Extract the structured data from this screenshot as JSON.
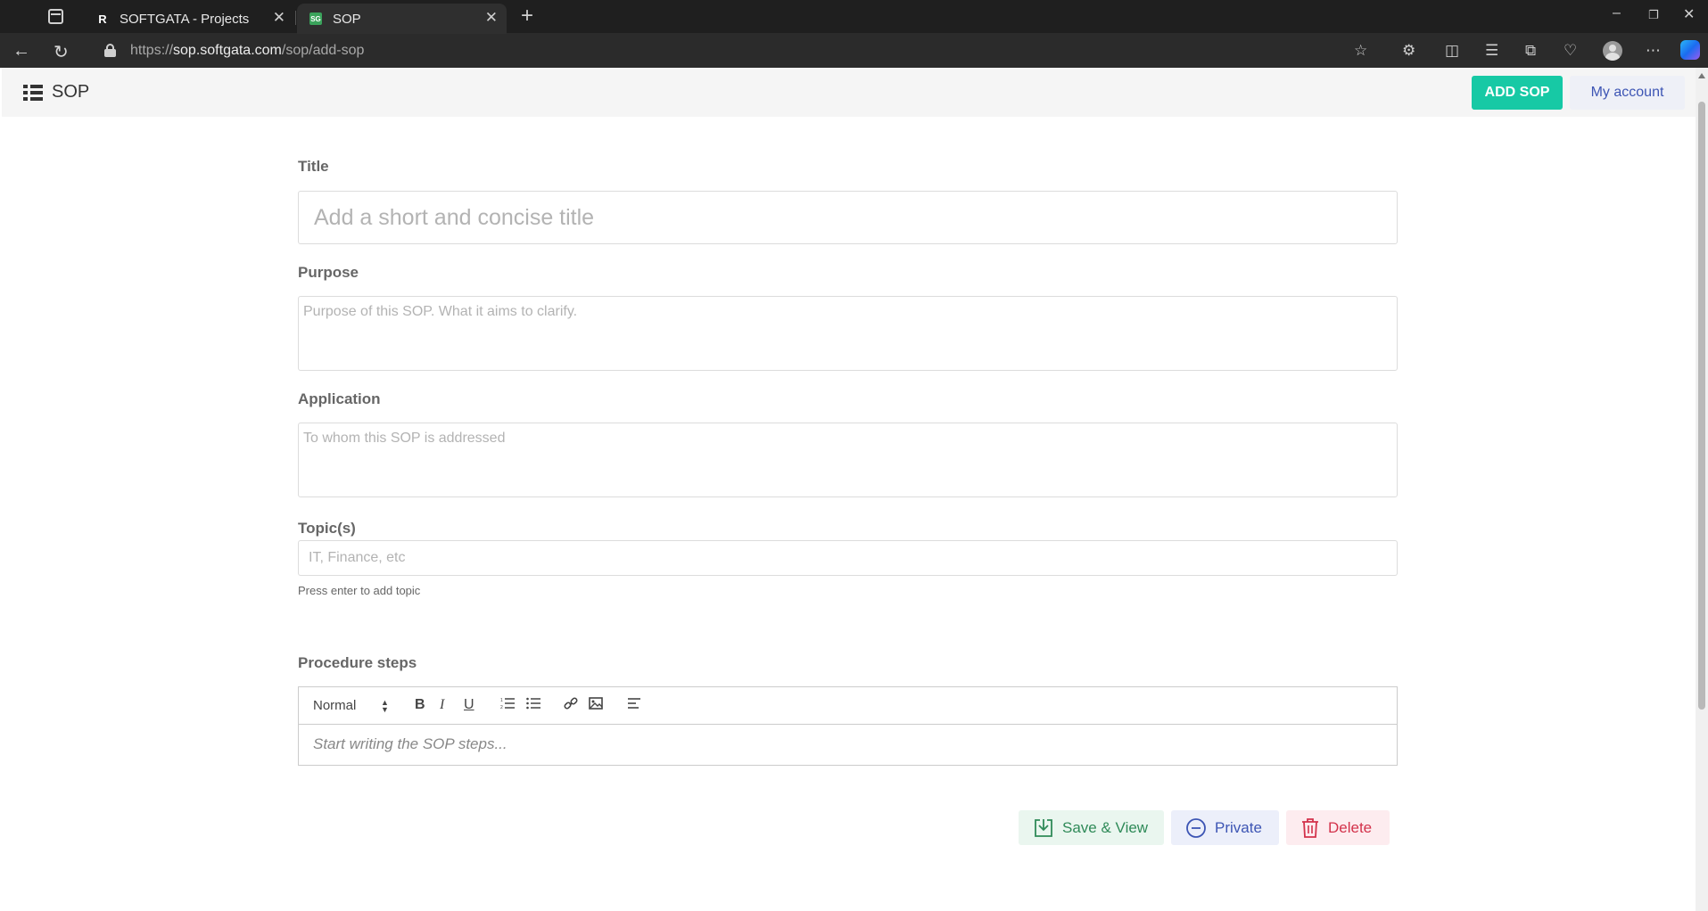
{
  "browser": {
    "tabs": [
      {
        "title": "SOFTGATA - Projects",
        "favicon": "R",
        "active": false
      },
      {
        "title": "SOP",
        "favicon": "SG",
        "active": true
      }
    ],
    "url_scheme": "https://",
    "url_host": "sop.softgata.com",
    "url_path": "/sop/add-sop"
  },
  "header": {
    "brand": "SOP",
    "add_sop_label": "ADD SOP",
    "my_account_label": "My account"
  },
  "form": {
    "title_label": "Title",
    "title_placeholder": "Add a short and concise title",
    "purpose_label": "Purpose",
    "purpose_placeholder": "Purpose of this SOP. What it aims to clarify.",
    "application_label": "Application",
    "application_placeholder": "To whom this SOP is addressed",
    "topics_label": "Topic(s)",
    "topics_placeholder": "IT, Finance, etc",
    "topics_help": "Press enter to add topic",
    "procedure_label": "Procedure steps",
    "editor_format": "Normal",
    "editor_placeholder": "Start writing the SOP steps..."
  },
  "actions": {
    "save_label": "Save & View",
    "private_label": "Private",
    "delete_label": "Delete"
  },
  "colors": {
    "add_sop": "#17c9a5",
    "save": "#2f8a58",
    "private": "#3d55b4",
    "delete": "#d3324b"
  }
}
